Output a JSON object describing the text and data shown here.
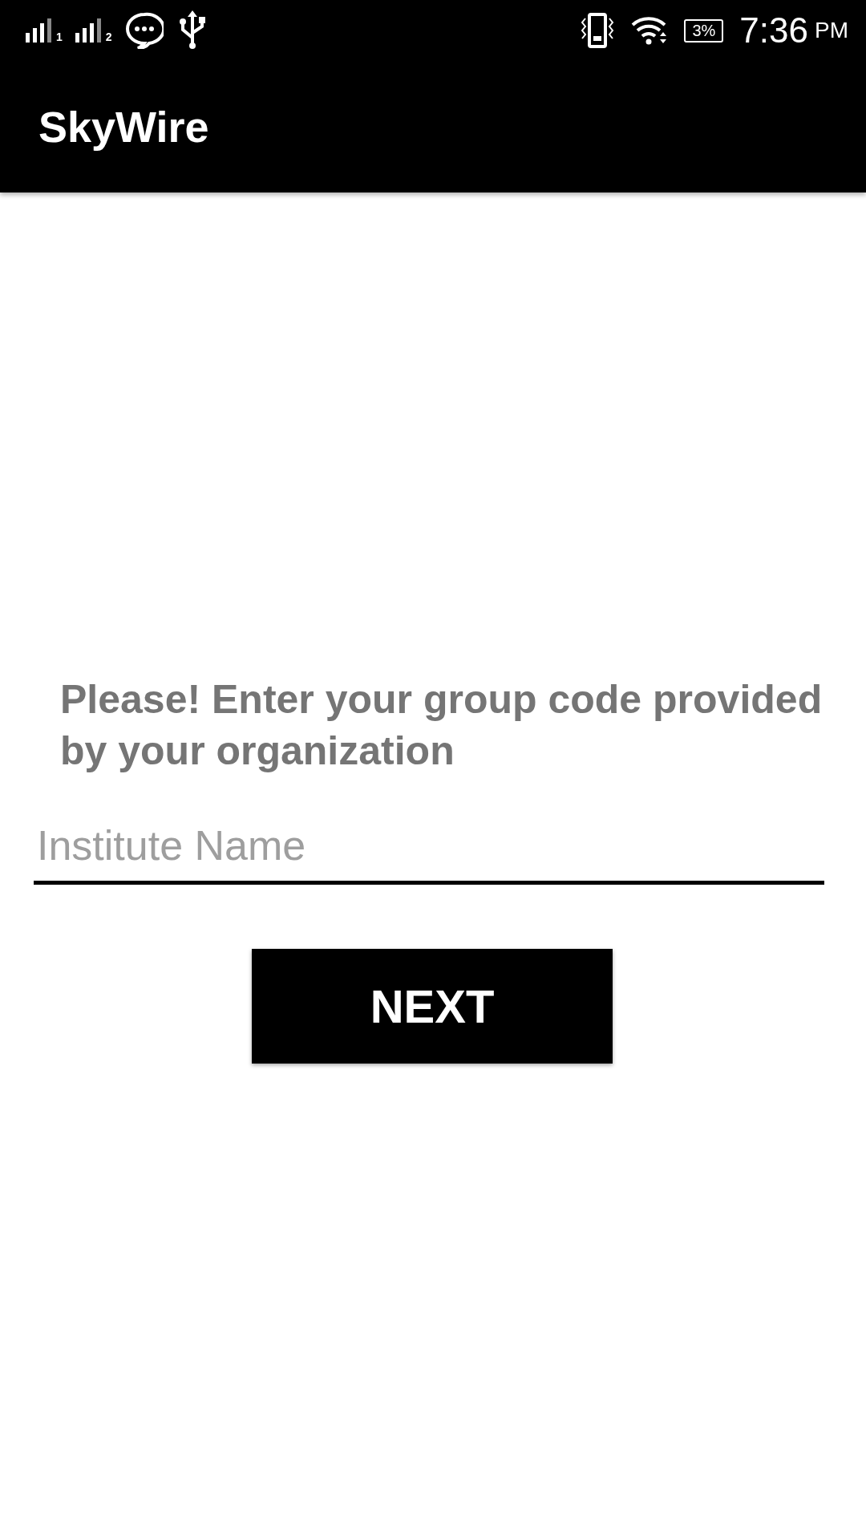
{
  "status_bar": {
    "sims": [
      {
        "label": "1"
      },
      {
        "label": "2"
      }
    ],
    "battery": "3%",
    "time": "7:36",
    "ampm": "PM"
  },
  "app_bar": {
    "title": "SkyWire"
  },
  "prompt": "Please! Enter your group code provided by your organization",
  "field": {
    "placeholder": "Institute Name"
  },
  "button": {
    "label": "NEXT"
  }
}
